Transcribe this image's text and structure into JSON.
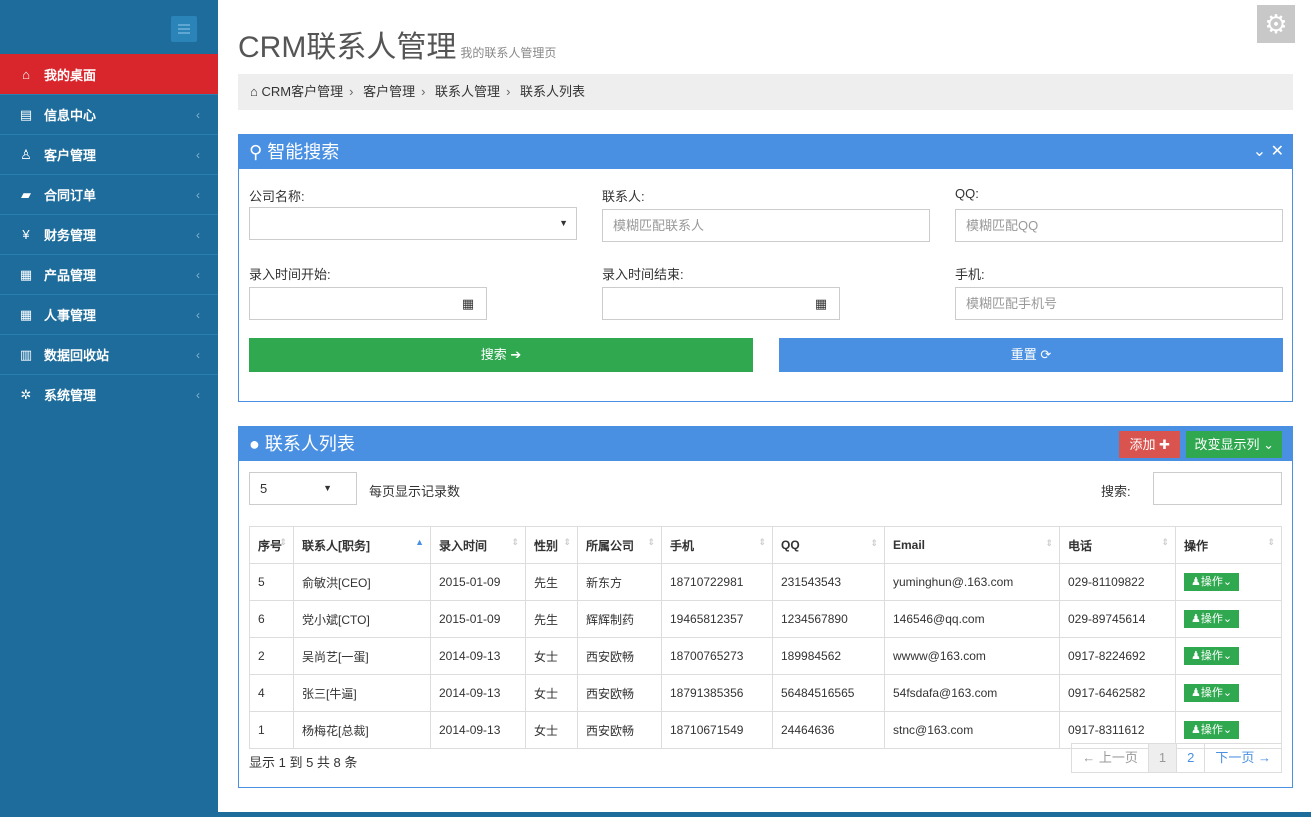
{
  "sidebar": {
    "items": [
      {
        "icon": "home-icon",
        "glyph": "⌂",
        "label": "我的桌面",
        "active": true
      },
      {
        "icon": "message-icon",
        "glyph": "▤",
        "label": "信息中心"
      },
      {
        "icon": "user-icon",
        "glyph": "♙",
        "label": "客户管理"
      },
      {
        "icon": "book-icon",
        "glyph": "▰",
        "label": "合同订单"
      },
      {
        "icon": "yen-icon",
        "glyph": "¥",
        "label": "财务管理"
      },
      {
        "icon": "table-icon",
        "glyph": "▦",
        "label": "产品管理"
      },
      {
        "icon": "table-icon",
        "glyph": "▦",
        "label": "人事管理"
      },
      {
        "icon": "trash-icon",
        "glyph": "▥",
        "label": "数据回收站"
      },
      {
        "icon": "gear-icon",
        "glyph": "✲",
        "label": "系统管理"
      }
    ]
  },
  "header": {
    "title": "CRM联系人管理",
    "subtitle": "我的联系人管理页",
    "breadcrumb": [
      "CRM客户管理",
      "客户管理",
      "联系人管理",
      "联系人列表"
    ]
  },
  "search": {
    "title": "智能搜索",
    "company_label": "公司名称:",
    "contact_label": "联系人:",
    "contact_placeholder": "模糊匹配联系人",
    "qq_label": "QQ:",
    "qq_placeholder": "模糊匹配QQ",
    "start_label": "录入时间开始:",
    "end_label": "录入时间结束:",
    "phone_label": "手机:",
    "phone_placeholder": "模糊匹配手机号",
    "search_button": "搜索 ➔",
    "reset_button": "重置 ⟳"
  },
  "list": {
    "title": "联系人列表",
    "add_button": "添加 ✚",
    "columns_button": "改变显示列 ⌄",
    "page_size": "5",
    "page_size_label": "每页显示记录数",
    "search_label": "搜索:",
    "headers": [
      "序号",
      "联系人[职务]",
      "录入时间",
      "性别",
      "所属公司",
      "手机",
      "QQ",
      "Email",
      "电话",
      "操作"
    ],
    "op_label": "♟操作⌄",
    "rows": [
      [
        "5",
        "俞敏洪[CEO]",
        "2015-01-09",
        "先生",
        "新东方",
        "18710722981",
        "231543543",
        "yuminghun@.163.com",
        "029-81109822"
      ],
      [
        "6",
        "党小斌[CTO]",
        "2015-01-09",
        "先生",
        "辉辉制药",
        "19465812357",
        "1234567890",
        "146546@qq.com",
        "029-89745614"
      ],
      [
        "2",
        "吴尚艺[一蛋]",
        "2014-09-13",
        "女士",
        "西安欧畅",
        "18700765273",
        "189984562",
        "wwww@163.com",
        "0917-8224692"
      ],
      [
        "4",
        "张三[牛逼]",
        "2014-09-13",
        "女士",
        "西安欧畅",
        "18791385356",
        "56484516565",
        "54fsdafa@163.com",
        "0917-6462582"
      ],
      [
        "1",
        "杨梅花[总裁]",
        "2014-09-13",
        "女士",
        "西安欧畅",
        "18710671549",
        "24464636",
        "stnc@163.com",
        "0917-8311612"
      ]
    ],
    "summary": "显示 1 到 5 共 8 条",
    "pager": {
      "prev": "← 上一页",
      "pages": [
        "1",
        "2"
      ],
      "next": "下一页 →"
    }
  }
}
